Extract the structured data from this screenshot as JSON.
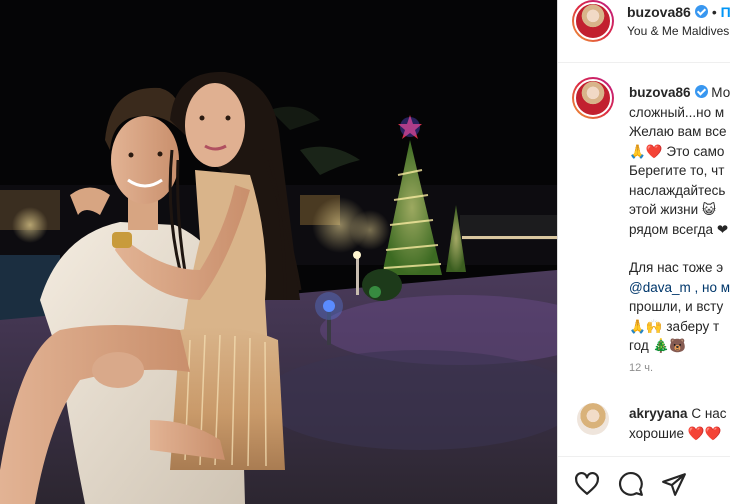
{
  "header": {
    "username": "buzova86",
    "follow_dot": "•",
    "follow_label": "П",
    "location": "You & Me Maldives"
  },
  "caption": {
    "username": "buzova86",
    "lines": [
      "Мо",
      "сложный...но м",
      "Желаю вам все",
      "🙏❤️ Это само",
      "Берегите то, чт",
      "наслаждайтесь",
      "этой жизни 😺",
      "рядом всегда ❤",
      "",
      "Для нас тоже э",
      "@dava_m , но м",
      "прошли, и всту",
      "🙏🙌 заберу т",
      "год 🎄🐻"
    ],
    "timestamp": "12 ч."
  },
  "comment": {
    "username": "akryyana",
    "text_1": "С нас",
    "text_2": "хорошие ❤️❤️"
  },
  "actions": {
    "like": "heart-icon",
    "comment": "comment-icon",
    "share": "share-icon"
  },
  "colors": {
    "link": "#00376b",
    "verified": "#3897f0",
    "heart": "#ed4956"
  }
}
